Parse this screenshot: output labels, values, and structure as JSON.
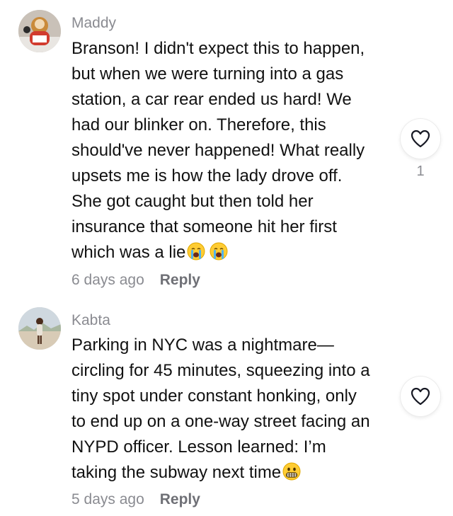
{
  "comments": [
    {
      "username": "Maddy",
      "lines": [
        "Branson! I didn't expect this to happen,",
        "but when we were turning into a gas",
        "station, a car rear ended us hard! We",
        "had our blinker on. Therefore, this",
        "should've never happened! What really",
        "upsets me is how the lady drove off.",
        "She got caught but then told her",
        "insurance that someone hit her first",
        "which was a lie"
      ],
      "trailing_emojis": [
        "loudly-crying-face-emoji",
        "loudly-crying-face-emoji"
      ],
      "time": "6 days ago",
      "reply_label": "Reply",
      "like_count": "1",
      "like_icon": "heart-outline-icon"
    },
    {
      "username": "Kabta",
      "lines": [
        "Parking in NYC was a nightmare—",
        "circling for 45 minutes, squeezing into a",
        "tiny spot under constant honking, only",
        "to end up on a one-way street facing an",
        "NYPD officer. Lesson learned: I’m",
        "taking the subway next time"
      ],
      "trailing_emojis": [
        "grimacing-face-emoji"
      ],
      "time": "5 days ago",
      "reply_label": "Reply",
      "like_count": "",
      "like_icon": "heart-outline-icon"
    }
  ],
  "colors": {
    "text": "#111111",
    "muted": "#8a8b91",
    "reply": "#6f7076",
    "emoji_face": "#ffcc33"
  }
}
